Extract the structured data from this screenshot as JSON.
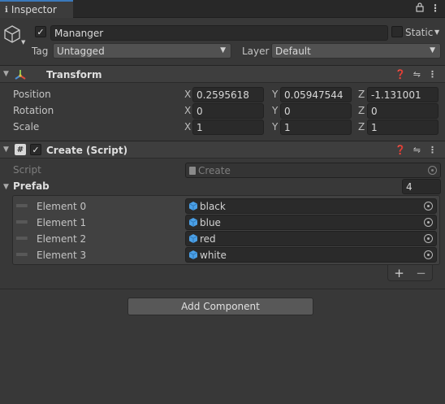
{
  "tab": {
    "label": "Inspector",
    "lock_icon": "lock-icon",
    "menu_icon": "kebab-menu-icon"
  },
  "object": {
    "active_checked": true,
    "name": "Mananger",
    "static_label": "Static",
    "static_checked": false,
    "tag_label": "Tag",
    "tag_value": "Untagged",
    "layer_label": "Layer",
    "layer_value": "Default"
  },
  "transform": {
    "title": "Transform",
    "rows": [
      {
        "label": "Position",
        "x": "0.2595618",
        "y": "0.05947544",
        "z": "-1.131001"
      },
      {
        "label": "Rotation",
        "x": "0",
        "y": "0",
        "z": "0"
      },
      {
        "label": "Scale",
        "x": "1",
        "y": "1",
        "z": "1"
      }
    ],
    "axes": {
      "x": "X",
      "y": "Y",
      "z": "Z"
    }
  },
  "create_script": {
    "title": "Create (Script)",
    "enabled": true,
    "script_label": "Script",
    "script_value": "Create",
    "prefab_label": "Prefab",
    "prefab_count": "4",
    "elements": [
      {
        "label": "Element 0",
        "value": "black"
      },
      {
        "label": "Element 1",
        "value": "blue"
      },
      {
        "label": "Element 2",
        "value": "red"
      },
      {
        "label": "Element 3",
        "value": "white"
      }
    ],
    "add_symbol": "+",
    "remove_symbol": "−"
  },
  "add_component_label": "Add Component"
}
